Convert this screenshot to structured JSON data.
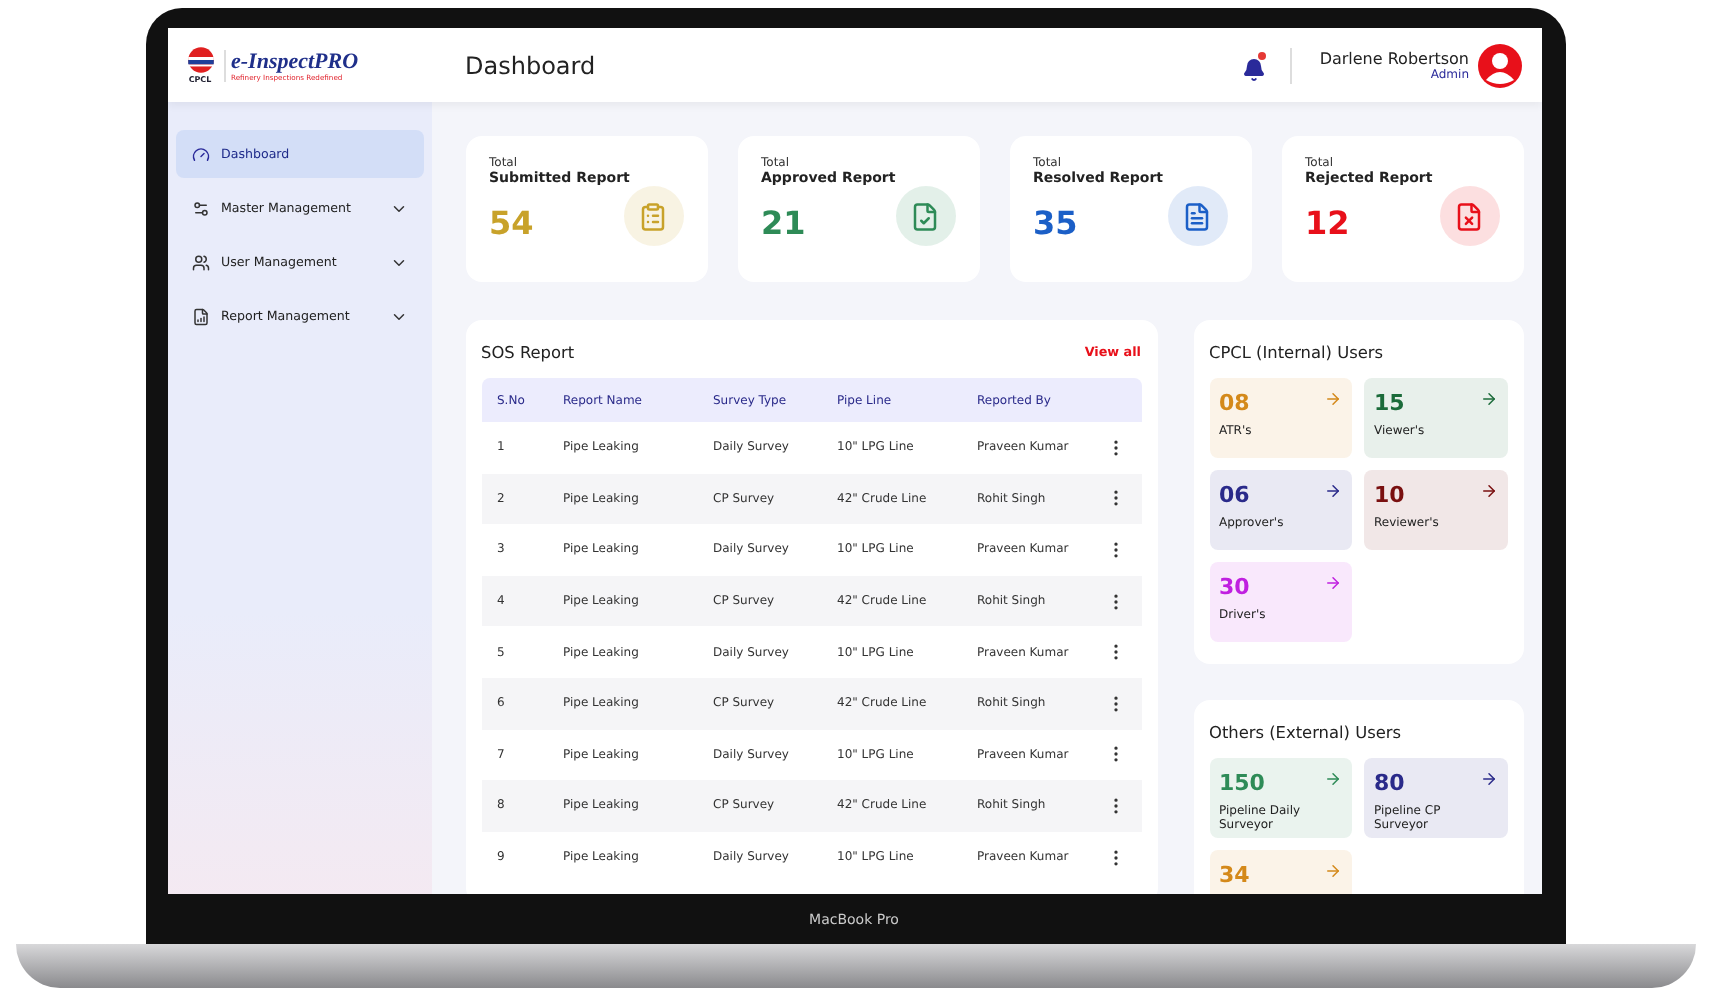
{
  "header": {
    "logo_text": "CPCL",
    "brand": "e-InspectPRO",
    "tagline": "Refinery Inspections Redefined",
    "title": "Dashboard",
    "has_unread": true,
    "user_name": "Darlene Robertson",
    "user_role": "Admin"
  },
  "sidebar": {
    "items": [
      {
        "label": "Dashboard",
        "kind": "dashboard",
        "selected": true,
        "expandable": false
      },
      {
        "label": "Master Management",
        "kind": "master",
        "selected": false,
        "expandable": true
      },
      {
        "label": "User Management",
        "kind": "users",
        "selected": false,
        "expandable": true
      },
      {
        "label": "Report Management",
        "kind": "reports",
        "selected": false,
        "expandable": true
      }
    ]
  },
  "stats": [
    {
      "caption": "Total",
      "label": "Submitted Report",
      "value": "54",
      "color": "#c8a22a",
      "kind": "clipboard"
    },
    {
      "caption": "Total",
      "label": "Approved Report",
      "value": "21",
      "color": "#2e8b57",
      "kind": "approved"
    },
    {
      "caption": "Total",
      "label": "Resolved Report",
      "value": "35",
      "color": "#1b5fc7",
      "kind": "resolved"
    },
    {
      "caption": "Total",
      "label": "Rejected Report",
      "value": "12",
      "color": "#e8101a",
      "kind": "rejected"
    }
  ],
  "sos_report": {
    "title": "SOS Report",
    "link": "View all",
    "columns": [
      "S.No",
      "Report Name",
      "Survey Type",
      "Pipe Line",
      "Reported By"
    ],
    "rows": [
      [
        "1",
        "Pipe Leaking",
        "Daily Survey",
        "10\" LPG Line",
        "Praveen Kumar"
      ],
      [
        "2",
        "Pipe Leaking",
        "CP Survey",
        "42\" Crude Line",
        "Rohit Singh"
      ],
      [
        "3",
        "Pipe Leaking",
        "Daily Survey",
        "10\" LPG Line",
        "Praveen Kumar"
      ],
      [
        "4",
        "Pipe Leaking",
        "CP Survey",
        "42\" Crude Line",
        "Rohit Singh"
      ],
      [
        "5",
        "Pipe Leaking",
        "Daily Survey",
        "10\" LPG Line",
        "Praveen Kumar"
      ],
      [
        "6",
        "Pipe Leaking",
        "CP Survey",
        "42\" Crude Line",
        "Rohit Singh"
      ],
      [
        "7",
        "Pipe Leaking",
        "Daily Survey",
        "10\" LPG Line",
        "Praveen Kumar"
      ],
      [
        "8",
        "Pipe Leaking",
        "CP Survey",
        "42\" Crude Line",
        "Rohit Singh"
      ],
      [
        "9",
        "Pipe Leaking",
        "Daily Survey",
        "10\" LPG Line",
        "Praveen Kumar"
      ]
    ]
  },
  "internal_users": {
    "title": "CPCL (Internal) Users",
    "tiles": [
      {
        "value": "08",
        "label": "ATR's",
        "color": "#d4891a"
      },
      {
        "value": "15",
        "label": "Viewer's",
        "color": "#1b6b3a"
      },
      {
        "value": "06",
        "label": "Approver's",
        "color": "#2a2a8a"
      },
      {
        "value": "10",
        "label": "Reviewer's",
        "color": "#7a1010"
      },
      {
        "value": "30",
        "label": "Driver's",
        "color": "#c020e0"
      }
    ]
  },
  "external_users": {
    "title": "Others (External) Users",
    "tiles": [
      {
        "value": "150",
        "label": "Pipeline Daily Surveyor",
        "color": "#2e8b57"
      },
      {
        "value": "80",
        "label": "Pipeline CP Surveyor",
        "color": "#2a2a8a"
      },
      {
        "value": "34",
        "color": "#d4891a"
      }
    ]
  },
  "device": {
    "label": "MacBook Pro"
  }
}
